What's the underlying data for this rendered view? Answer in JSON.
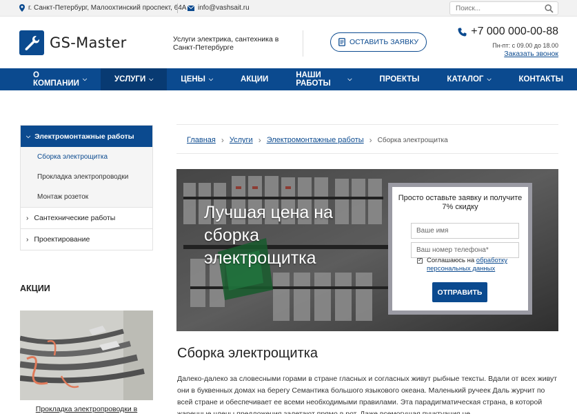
{
  "topbar": {
    "address": "г. Санкт-Петербург, Малоохтинский проспект, 64А",
    "email": "info@vashsait.ru",
    "search_placeholder": "Поиск...",
    "icons": [
      "map-pin-icon",
      "mail-icon",
      "search-icon"
    ]
  },
  "header": {
    "logo_text": "GS-Master",
    "tagline": "Услуги электрика, сантехника в Санкт-Петербурге",
    "order_button": "ОСТАВИТЬ ЗАЯВКУ",
    "phone": "+7 000 000-00-88",
    "hours": "Пн-пт: с 09.00 до 18.00",
    "callback": "Заказать звонок"
  },
  "nav": {
    "items": [
      {
        "label": "О КОМПАНИИ",
        "dropdown": true
      },
      {
        "label": "УСЛУГИ",
        "dropdown": true,
        "active": true
      },
      {
        "label": "ЦЕНЫ",
        "dropdown": true
      },
      {
        "label": "АКЦИИ",
        "dropdown": false
      },
      {
        "label": "НАШИ РАБОТЫ",
        "dropdown": true
      },
      {
        "label": "ПРОЕКТЫ",
        "dropdown": false
      },
      {
        "label": "КАТАЛОГ",
        "dropdown": true
      },
      {
        "label": "КОНТАКТЫ",
        "dropdown": false
      }
    ]
  },
  "sidebar": {
    "open_section": "Электромонтажные работы",
    "sub_items": [
      "Сборка электрощитка",
      "Прокладка электропроводки",
      "Монтаж розеток"
    ],
    "sections": [
      "Сантехнические работы",
      "Проектирование"
    ],
    "aktsii_title": "АКЦИИ",
    "aktsii_link": "Прокладка электропроводки в"
  },
  "breadcrumb": {
    "items": [
      "Главная",
      "Услуги",
      "Электромонтажные работы"
    ],
    "current": "Сборка электрощитка"
  },
  "hero": {
    "title": "Лучшая цена на сборка электрощитка",
    "form": {
      "title": "Просто оставьте заявку и получите 7% скидку",
      "name_placeholder": "Ваше имя",
      "phone_placeholder": "Ваш номер телефона*",
      "agree_text": "Соглашаюсь на",
      "agree_link": "обработку персональных данных",
      "submit": "ОТПРАВИТЬ"
    }
  },
  "main": {
    "title": "Сборка электрощитка",
    "text": "Далеко-далеко за словесными горами в стране гласных и согласных живут рыбные тексты. Вдали от всех живут они в буквенных домах на берегу Семантика большого языкового океана. Маленький ручеек Даль журчит по всей стране и обеспечивает ее всеми необходимыми правилами. Эта парадигматическая страна, в которой жаренные члены предложения залетают прямо в рот. Даже всемогущая пунктуация не"
  },
  "colors": {
    "brand_blue": "#0b4a8f",
    "nav_active": "#083a72",
    "topbar_bg": "#f2f2f2"
  }
}
